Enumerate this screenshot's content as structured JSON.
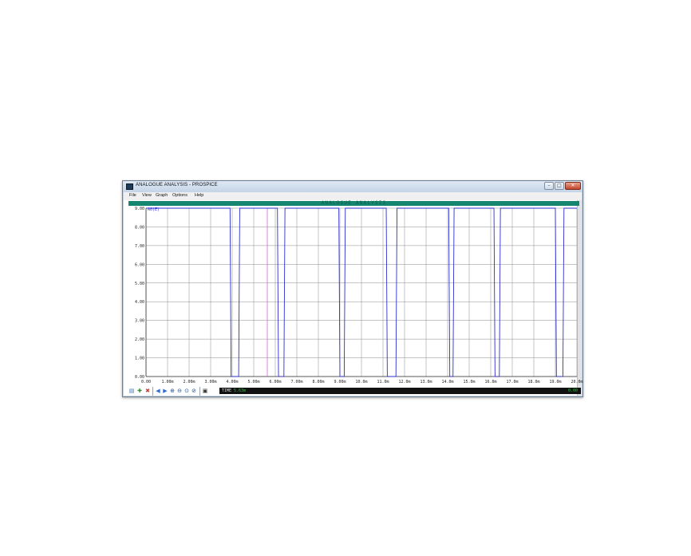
{
  "window": {
    "title": "ANALOGUE ANALYSIS - PROSPICE",
    "controls": {
      "minimize": "–",
      "maximize": "□",
      "close": "✕"
    }
  },
  "menu": [
    "File",
    "View",
    "Graph",
    "Options",
    "Help"
  ],
  "graph": {
    "title": "ANALOGUE ANALYSIS",
    "header_color": "#14866f"
  },
  "toolbar": {
    "icons": [
      "graph-properties-icon",
      "add-trace-icon",
      "delete-trace-icon",
      "arrow-left-icon",
      "arrow-right-icon",
      "zoom-in-icon",
      "zoom-out-icon",
      "zoom-all-icon",
      "zoom-area-icon",
      "view-log-icon"
    ]
  },
  "status": {
    "label": "TIME",
    "value": "5.63m",
    "right": "0.00"
  },
  "colors": {
    "trace": "#2b2fd1",
    "cursor": "#d050d0",
    "grid": "#8a8a8a",
    "status_text": "#29c23c",
    "header": "#14866f"
  },
  "chart_data": {
    "type": "line",
    "title": "ANALOGUE ANALYSIS",
    "series": [
      {
        "name": "A0(E)",
        "color": "#2b2fd1",
        "x": [
          0.0,
          3.9,
          3.95,
          4.3,
          4.35,
          6.1,
          6.15,
          6.4,
          6.45,
          8.95,
          9.0,
          9.2,
          9.25,
          11.15,
          11.2,
          11.6,
          11.65,
          14.05,
          14.1,
          14.25,
          14.3,
          16.15,
          16.2,
          16.4,
          16.45,
          19.0,
          19.05,
          19.35,
          19.4,
          20.0
        ],
        "y": [
          9.0,
          9.0,
          0.0,
          0.0,
          9.0,
          9.0,
          0.0,
          0.0,
          9.0,
          9.0,
          0.0,
          0.0,
          9.0,
          9.0,
          0.0,
          0.0,
          9.0,
          9.0,
          0.0,
          0.0,
          9.0,
          9.0,
          0.0,
          0.0,
          9.0,
          9.0,
          0.0,
          0.0,
          9.0,
          9.0
        ]
      }
    ],
    "y_tick_labels": [
      "0.00",
      "1.00",
      "2.00",
      "3.00",
      "4.00",
      "5.00",
      "6.00",
      "7.00",
      "8.00",
      "9.00"
    ],
    "x_tick_labels": [
      "0.00",
      "1.00m",
      "2.00m",
      "3.00m",
      "4.00m",
      "5.00m",
      "6.00m",
      "7.00m",
      "8.00m",
      "9.00m",
      "10.0m",
      "11.0m",
      "12.0m",
      "13.0m",
      "14.0m",
      "15.0m",
      "16.0m",
      "17.0m",
      "18.0m",
      "19.0m",
      "20.0m"
    ],
    "xlim": [
      0,
      20
    ],
    "ylim": [
      0,
      9
    ],
    "cursor_x": 5.63,
    "grid": true
  }
}
